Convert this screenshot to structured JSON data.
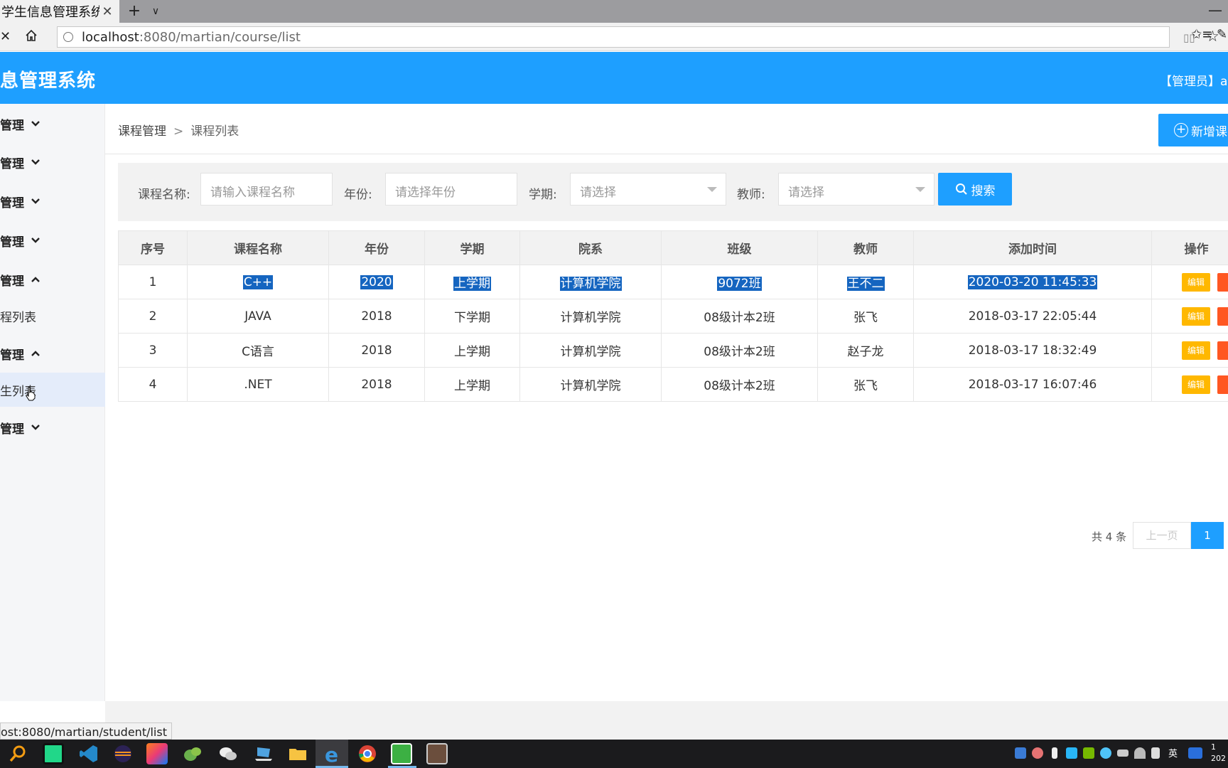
{
  "browser": {
    "tab_title": "学生信息管理系统",
    "url_host": "localhost",
    "url_rest": ":8080/martian/course/list",
    "status_url": "ost:8080/martian/student/list"
  },
  "header": {
    "title": "息管理系统",
    "user": "【管理员】ac"
  },
  "sidebar": {
    "items": [
      {
        "label": "管理",
        "type": "group",
        "expanded": false
      },
      {
        "label": "管理",
        "type": "group",
        "expanded": false
      },
      {
        "label": "管理",
        "type": "group",
        "expanded": false
      },
      {
        "label": "管理",
        "type": "group",
        "expanded": false
      },
      {
        "label": "管理",
        "type": "group",
        "expanded": true
      },
      {
        "label": "程列表",
        "type": "item",
        "active": false
      },
      {
        "label": "管理",
        "type": "group",
        "expanded": true
      },
      {
        "label": "生列表",
        "type": "item",
        "active": true
      },
      {
        "label": "管理",
        "type": "group",
        "expanded": false
      }
    ]
  },
  "breadcrumb": {
    "parent": "课程管理",
    "separator": ">",
    "current": "课程列表"
  },
  "add_button": {
    "label": "新增课"
  },
  "search": {
    "name_label": "课程名称:",
    "name_placeholder": "请输入课程名称",
    "year_label": "年份:",
    "year_placeholder": "请选择年份",
    "term_label": "学期:",
    "term_value": "请选择",
    "teacher_label": "教师:",
    "teacher_value": "请选择",
    "button": "搜索"
  },
  "table": {
    "headers": [
      "序号",
      "课程名称",
      "年份",
      "学期",
      "院系",
      "班级",
      "教师",
      "添加时间",
      "操作"
    ],
    "rows": [
      [
        "1",
        "C++",
        "2020",
        "上学期",
        "计算机学院",
        "9072班",
        "王不二",
        "2020-03-20 11:45:33"
      ],
      [
        "2",
        "JAVA",
        "2018",
        "下学期",
        "计算机学院",
        "08级计本2班",
        "张飞",
        "2018-03-17 22:05:44"
      ],
      [
        "3",
        "C语言",
        "2018",
        "上学期",
        "计算机学院",
        "08级计本2班",
        "赵子龙",
        "2018-03-17 18:32:49"
      ],
      [
        "4",
        ".NET",
        "2018",
        "上学期",
        "计算机学院",
        "08级计本2班",
        "张飞",
        "2018-03-17 16:07:46"
      ]
    ],
    "edit_label": "编辑"
  },
  "pagination": {
    "total": "共 4 条",
    "prev": "上一页",
    "current": "1"
  },
  "taskbar": {
    "ime": "英",
    "clock": "1",
    "date": "202"
  },
  "colors": {
    "primary": "#1e9fff",
    "edit": "#ffb800",
    "delete": "#ff5722",
    "selection": "#1565c0"
  }
}
